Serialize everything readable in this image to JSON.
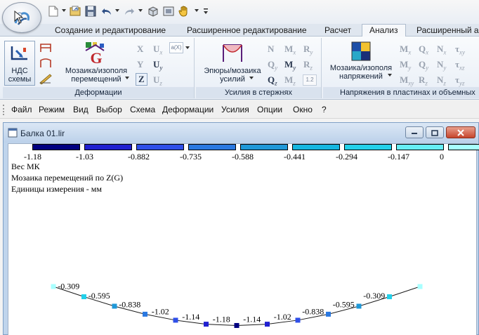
{
  "app": {
    "orb_icon": "lira-logo-icon",
    "quick_access_icons": [
      "new-file-icon",
      "open-file-icon",
      "save-icon",
      "undo-icon",
      "redo-icon",
      "view-3d-icon",
      "view-icon",
      "hand-icon",
      "customize-icon"
    ]
  },
  "ribbon": {
    "tabs": [
      {
        "label": "Создание и редактирование"
      },
      {
        "label": "Расширенное редактирование"
      },
      {
        "label": "Расчет"
      },
      {
        "label": "Анализ"
      },
      {
        "label": "Расширенный ана"
      }
    ],
    "active_tab": "Анализ",
    "groups": {
      "deformations": {
        "title": "Деформации",
        "ndc_label_line1": "НДС",
        "ndc_label_line2": "схемы",
        "mosaic_label_line1": "Мозаика/изополя",
        "mosaic_label_line2": "перемещений",
        "axes": [
          "X",
          "Y",
          "Z"
        ],
        "rotations": [
          "U",
          "U",
          "U"
        ],
        "rotation_subs": [
          "x",
          "y",
          "z"
        ],
        "extra": "a(X)"
      },
      "forces": {
        "title": "Усилия в стержнях",
        "epure_label_line1": "Эпюры/мозаика",
        "epure_label_line2": "усилий",
        "symbols": [
          {
            "main": "N",
            "sub": ""
          },
          {
            "main": "M",
            "sub": "x"
          },
          {
            "main": "R",
            "sub": "y"
          },
          {
            "main": "Q",
            "sub": "y"
          },
          {
            "main": "M",
            "sub": "y"
          },
          {
            "main": "R",
            "sub": "z"
          },
          {
            "main": "Q",
            "sub": "z"
          },
          {
            "main": "M",
            "sub": "z"
          },
          {
            "main": "1.2",
            "sub": ""
          }
        ]
      },
      "stresses": {
        "title": "Напряжения в пластинах и объемных",
        "mosaic_label_line1": "Мозаика/изополя",
        "mosaic_label_line2": "напряжений",
        "symbols": [
          {
            "main": "M",
            "sub": "x"
          },
          {
            "main": "Q",
            "sub": "x"
          },
          {
            "main": "N",
            "sub": "x"
          },
          {
            "main": "τ",
            "sub": "xy"
          },
          {
            "main": "M",
            "sub": "y"
          },
          {
            "main": "Q",
            "sub": "y"
          },
          {
            "main": "N",
            "sub": "y"
          },
          {
            "main": "τ",
            "sub": "xz"
          },
          {
            "main": "M",
            "sub": "xy"
          },
          {
            "main": "R",
            "sub": "z"
          },
          {
            "main": "N",
            "sub": "z"
          },
          {
            "main": "τ",
            "sub": "yz"
          }
        ]
      }
    }
  },
  "menu": [
    "Файл",
    "Режим",
    "Вид",
    "Выбор",
    "Схема",
    "Деформации",
    "Усилия",
    "Опции",
    "Окно",
    "?"
  ],
  "document": {
    "title": "Балка 01.lir",
    "info_lines": [
      "Вес МК",
      "Мозаика перемещений по Z(G)",
      "Единицы измерения - мм"
    ]
  },
  "legend": {
    "colors": [
      "#000080",
      "#2020d0",
      "#2f4fe8",
      "#2a78e0",
      "#1f98d8",
      "#14b6e0",
      "#22d0ea",
      "#66eef5",
      "#a8ffff"
    ],
    "labels": [
      "-1.18",
      "-1.03",
      "-0.882",
      "-0.735",
      "-0.588",
      "-0.441",
      "-0.294",
      "-0.147",
      "0"
    ]
  },
  "beam": {
    "node_colors": [
      "#a8ffff",
      "#22d0ea",
      "#1f98d8",
      "#2a78e0",
      "#2f4fe8",
      "#2020d0",
      "#000080",
      "#2020d0",
      "#2f4fe8",
      "#2a78e0",
      "#1f98d8",
      "#22d0ea",
      "#a8ffff"
    ],
    "node_values": [
      0,
      -0.309,
      -0.595,
      -0.838,
      -1.02,
      -1.14,
      -1.18,
      -1.14,
      -1.02,
      -0.838,
      -0.595,
      -0.309,
      0
    ],
    "element_labels": [
      "-0.309",
      "-0.595",
      "-0.838",
      "-1.02",
      "-1.14",
      "-1.18",
      "-1.14",
      "-1.02",
      "-0.838",
      "-0.595",
      "-0.309"
    ]
  }
}
